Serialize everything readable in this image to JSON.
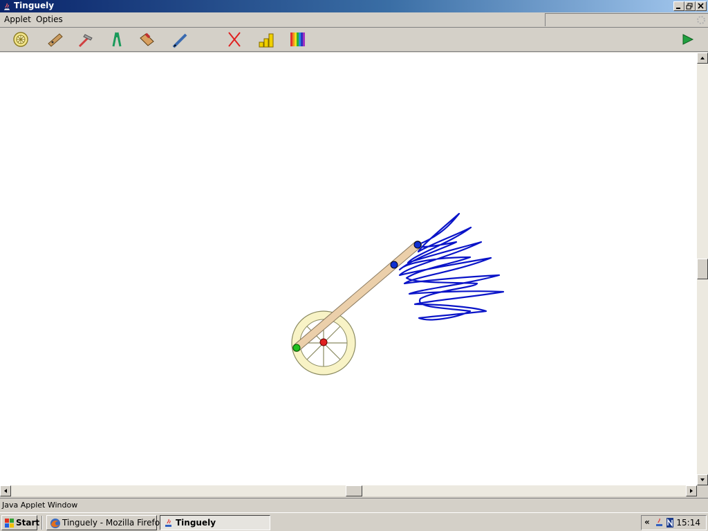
{
  "window": {
    "title": "Tinguely"
  },
  "menu": {
    "items": [
      "Applet",
      "Opties"
    ]
  },
  "toolbar": {
    "tools": [
      {
        "icon": "wheel-icon"
      },
      {
        "icon": "wood-plank-icon"
      },
      {
        "icon": "hammer-icon"
      },
      {
        "icon": "pliers-icon"
      },
      {
        "icon": "eraser-icon"
      },
      {
        "icon": "pencil-icon"
      },
      {
        "icon": "delete-x-icon"
      },
      {
        "icon": "speed-bars-icon"
      },
      {
        "icon": "color-palette-icon"
      }
    ],
    "play_icon": "play-icon"
  },
  "status": {
    "text": "Java Applet Window"
  },
  "taskbar": {
    "start_label": "Start",
    "tasks": [
      {
        "label": "Tinguely - Mozilla Firefox",
        "active": false
      },
      {
        "label": "Tinguely",
        "active": true
      }
    ],
    "tray_text": "«",
    "clock": "15:14"
  },
  "colors": {
    "title_start": "#0a246a",
    "title_end": "#a6caf0",
    "stroke_blue": "#0a14c8",
    "rod": "#ebcfaa",
    "wheel": "#f5f0c0"
  }
}
